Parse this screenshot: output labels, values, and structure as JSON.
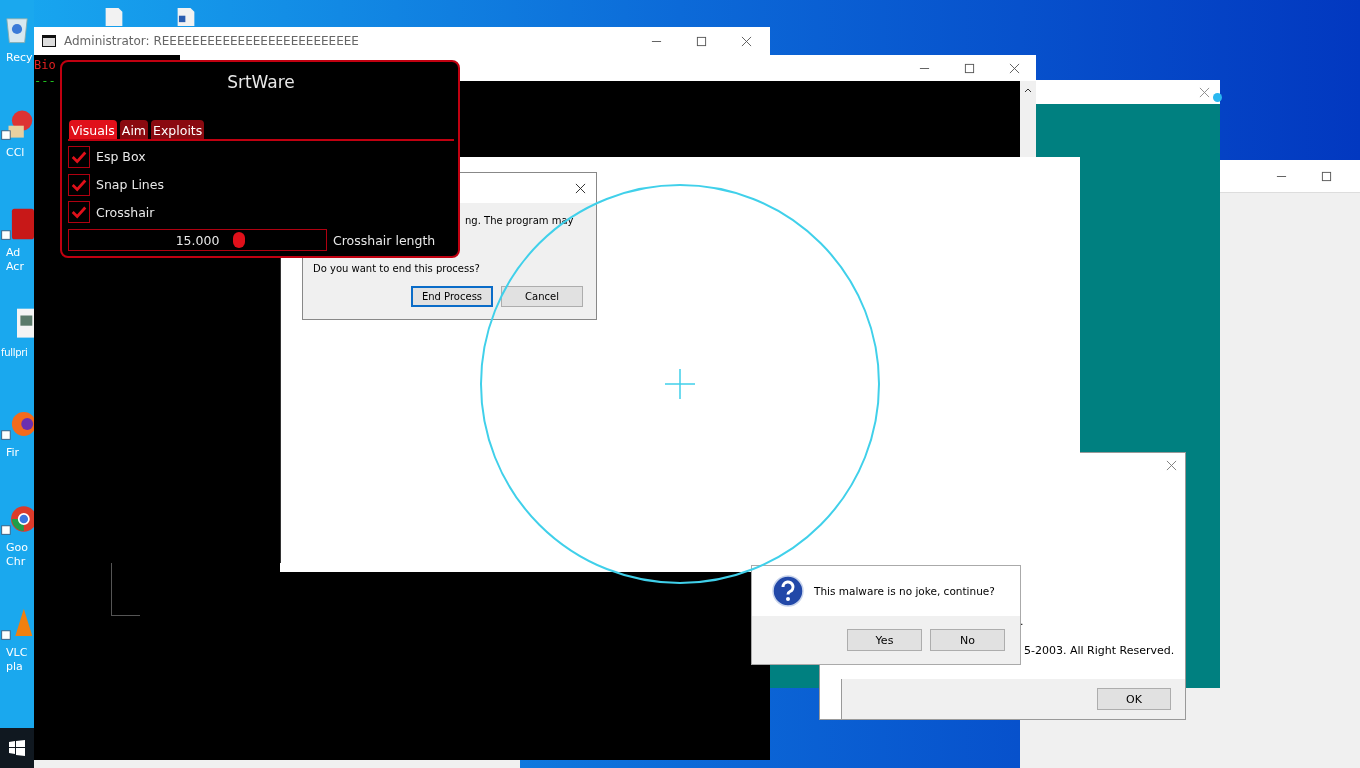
{
  "desktop_icons": [
    {
      "kind": "bin",
      "lines": [
        "Recy"
      ]
    },
    {
      "kind": "app",
      "lines": [
        "CCl"
      ]
    },
    {
      "kind": "pdf",
      "lines": [
        "Ad",
        "Acr"
      ]
    },
    {
      "kind": "image",
      "lines": [
        "fullpri"
      ]
    },
    {
      "kind": "firefox",
      "lines": [
        "Fir"
      ]
    },
    {
      "kind": "chrome",
      "lines": [
        "Goo",
        "Chr"
      ]
    },
    {
      "kind": "vlc",
      "lines": [
        "VLC",
        "pla"
      ]
    }
  ],
  "console_window": {
    "title": "Administrator:  REEEEEEEEEEEEEEEEEEEEEEEEEE",
    "lines": [
      {
        "text": "Bio",
        "color": "#e02020"
      },
      {
        "text": "---",
        "color": "#20c020"
      }
    ]
  },
  "srtware": {
    "title": "SrtWare",
    "tabs": [
      {
        "label": "Visuals",
        "selected": true
      },
      {
        "label": "Aim",
        "selected": false
      },
      {
        "label": "Exploits",
        "selected": false
      }
    ],
    "options": [
      {
        "label": "Esp Box",
        "checked": true
      },
      {
        "label": "Snap Lines",
        "checked": true
      },
      {
        "label": "Crosshair",
        "checked": true
      }
    ],
    "slider": {
      "value": "15.000",
      "level": 0.66,
      "label": "Crosshair length"
    }
  },
  "end_process_dialog": {
    "text": "ng. The program may",
    "question": "Do you want to end this process?",
    "buttons": [
      {
        "label": "End Process",
        "focused": true
      },
      {
        "label": "Cancel",
        "focused": false
      }
    ]
  },
  "message_box": {
    "text": "This malware is no joke, continue?",
    "buttons": [
      {
        "label": "Yes"
      },
      {
        "label": "No"
      }
    ]
  },
  "about_dialog": {
    "fragment": ".",
    "copyright": "5-2003. All Right Reserved.",
    "button": "OK"
  }
}
